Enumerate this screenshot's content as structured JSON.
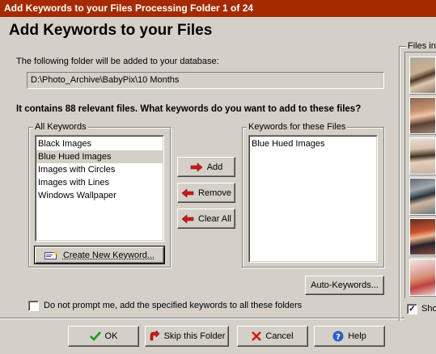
{
  "window": {
    "title": "Add Keywords to your Files Processing Folder 1 of 24"
  },
  "header": {
    "title": "Add Keywords to your Files"
  },
  "folder": {
    "label": "The following folder will be added to your database:",
    "path": "D:\\Photo_Archive\\BabyPix\\10 Months"
  },
  "prompt": "It contains 88 relevant files.  What keywords do you want to add to these files?",
  "all_keywords": {
    "label": "All Keywords",
    "items": [
      "Black Images",
      "Blue Hued Images",
      "Images with Circles",
      "Images with Lines",
      "Windows Wallpaper"
    ],
    "selected_index": 1,
    "create_button": "Create New Keyword..."
  },
  "actions": {
    "add": "Add",
    "remove": "Remove",
    "clear_all": "Clear All"
  },
  "file_keywords": {
    "label": "Keywords for these Files",
    "items": [
      "Blue Hued Images"
    ]
  },
  "auto_keywords_button": "Auto-Keywords...",
  "no_prompt_checkbox": {
    "label": "Do not prompt me, add the specified keywords to all these folders",
    "checked": false
  },
  "files_panel": {
    "label": "Files in",
    "thumbnail_count": 6,
    "show_label": "Sho",
    "show_checked": true
  },
  "footer": {
    "ok": "OK",
    "skip": "Skip this Folder",
    "cancel": "Cancel",
    "help": "Help"
  },
  "colors": {
    "titlebar": "#a52a00",
    "dialog_bg": "#d4d0c8",
    "arrow_red": "#d01818",
    "ok_green": "#1a9a1a",
    "help_blue": "#2a5fc8"
  }
}
